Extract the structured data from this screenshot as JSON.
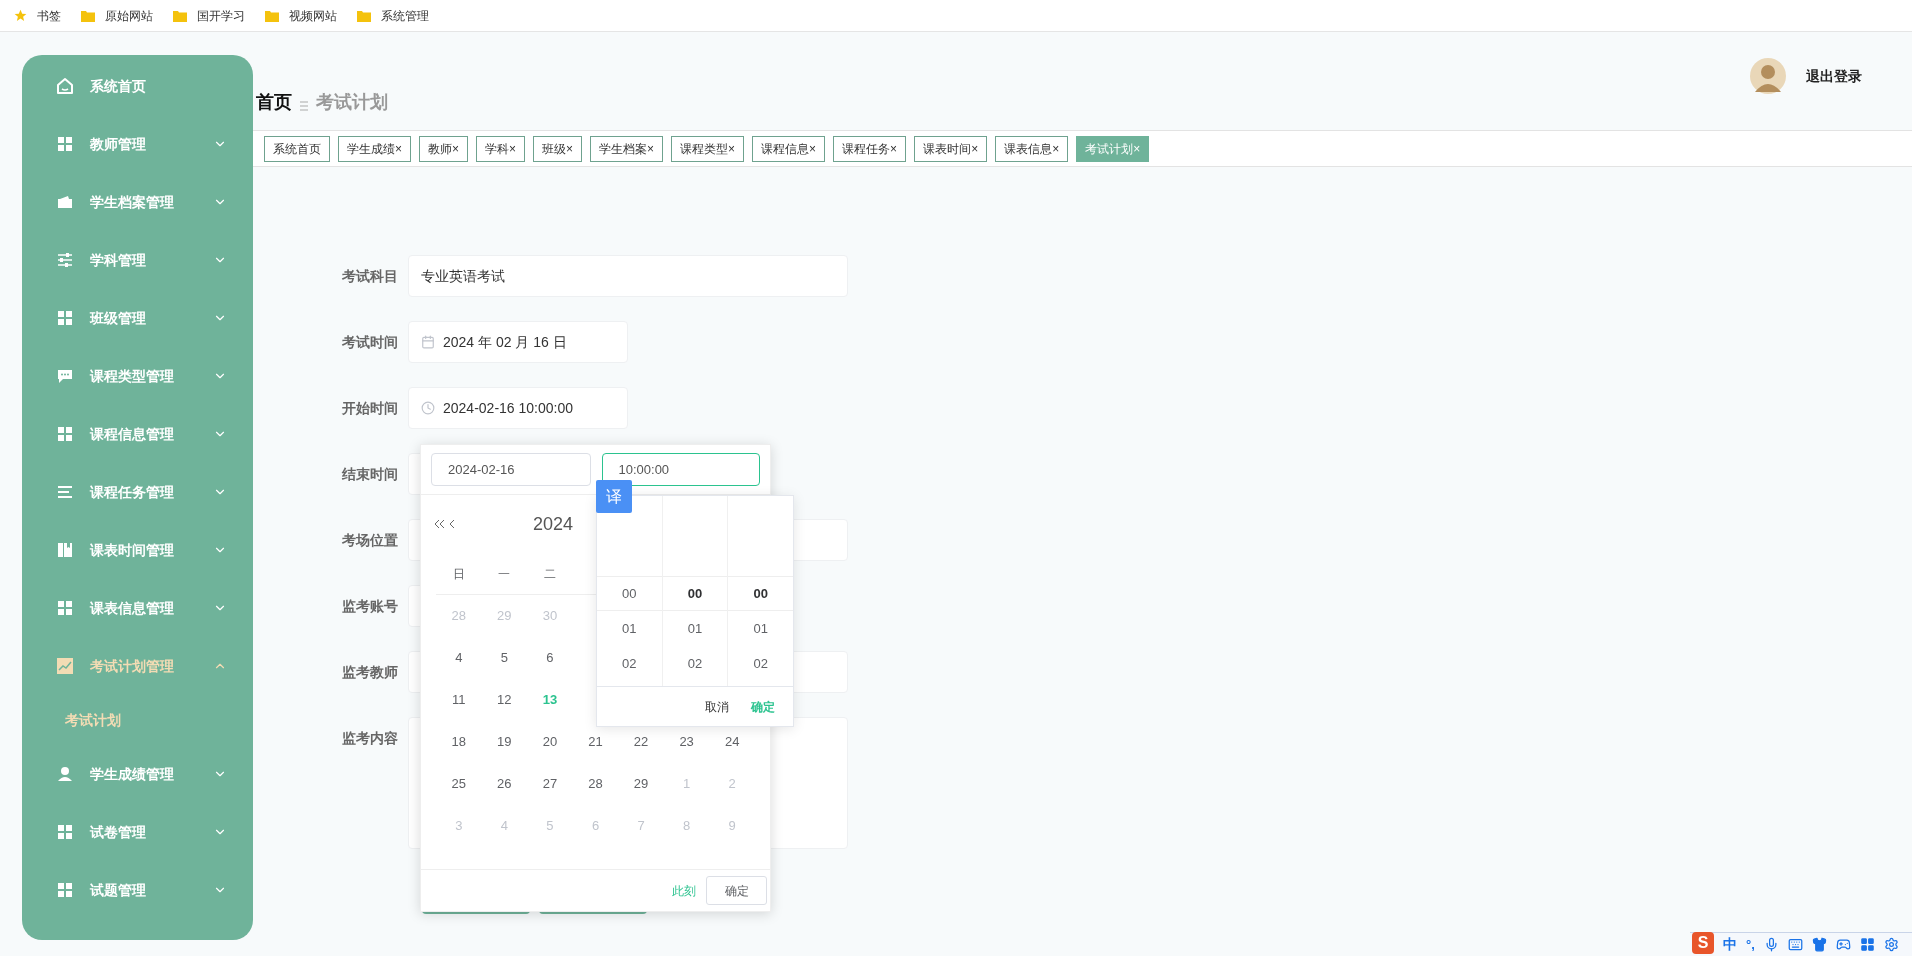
{
  "bookmarks": [
    {
      "label": "书签",
      "kind": "star"
    },
    {
      "label": "原始网站",
      "kind": "folder"
    },
    {
      "label": "国开学习",
      "kind": "folder"
    },
    {
      "label": "视频网站",
      "kind": "folder"
    },
    {
      "label": "系统管理",
      "kind": "folder"
    }
  ],
  "sidebar": {
    "items": [
      {
        "label": "系统首页",
        "kind": "home",
        "selected": false
      },
      {
        "label": "教师管理",
        "kind": "grid",
        "selected": false,
        "expanded": false
      },
      {
        "label": "学生档案管理",
        "kind": "wallet",
        "selected": false,
        "expanded": false
      },
      {
        "label": "学科管理",
        "kind": "sliders",
        "selected": false,
        "expanded": false
      },
      {
        "label": "班级管理",
        "kind": "grid",
        "selected": false,
        "expanded": false
      },
      {
        "label": "课程类型管理",
        "kind": "chat",
        "selected": false,
        "expanded": false
      },
      {
        "label": "课程信息管理",
        "kind": "grid",
        "selected": false,
        "expanded": false
      },
      {
        "label": "课程任务管理",
        "kind": "list",
        "selected": false,
        "expanded": false
      },
      {
        "label": "课表时间管理",
        "kind": "book",
        "selected": false,
        "expanded": false
      },
      {
        "label": "课表信息管理",
        "kind": "grid",
        "selected": false,
        "expanded": false
      },
      {
        "label": "考试计划管理",
        "kind": "chart",
        "selected": true,
        "expanded": true,
        "children": [
          {
            "label": "考试计划",
            "selected": true
          }
        ]
      },
      {
        "label": "学生成绩管理",
        "kind": "user",
        "selected": false,
        "expanded": false
      },
      {
        "label": "试卷管理",
        "kind": "grid",
        "selected": false,
        "expanded": false
      },
      {
        "label": "试题管理",
        "kind": "grid",
        "selected": false,
        "expanded": false
      }
    ]
  },
  "breadcrumb": {
    "home": "首页",
    "current": "考试计划"
  },
  "user": {
    "logout": "退出登录"
  },
  "tabs": [
    {
      "label": "系统首页",
      "selected": false
    },
    {
      "label": "学生成绩",
      "close": "×",
      "selected": false
    },
    {
      "label": "教师",
      "close": "×",
      "selected": false
    },
    {
      "label": "学科",
      "close": "×",
      "selected": false
    },
    {
      "label": "班级",
      "close": "×",
      "selected": false
    },
    {
      "label": "学生档案",
      "close": "×",
      "selected": false
    },
    {
      "label": "课程类型",
      "close": "×",
      "selected": false
    },
    {
      "label": "课程信息",
      "close": "×",
      "selected": false
    },
    {
      "label": "课程任务",
      "close": "×",
      "selected": false
    },
    {
      "label": "课表时间",
      "close": "×",
      "selected": false
    },
    {
      "label": "课表信息",
      "close": "×",
      "selected": false
    },
    {
      "label": "考试计划",
      "close": "×",
      "selected": true
    }
  ],
  "form": {
    "fields": [
      {
        "label": "考试科目",
        "kind": "text",
        "value": "专业英语考试"
      },
      {
        "label": "考试时间",
        "kind": "date",
        "value": "2024 年 02 月 16 日"
      },
      {
        "label": "开始时间",
        "kind": "datetime",
        "value": "2024-02-16 10:00:00"
      },
      {
        "label": "结束时间",
        "kind": "short"
      },
      {
        "label": "考场位置",
        "kind": "text"
      },
      {
        "label": "监考账号",
        "kind": "short"
      },
      {
        "label": "监考教师",
        "kind": "text"
      },
      {
        "label": "监考内容",
        "kind": "textarea"
      }
    ],
    "actions": [
      {
        "kind": "button"
      },
      {
        "kind": "button"
      }
    ]
  },
  "picker": {
    "date_input": "2024-02-16",
    "time_input": "10:00:00",
    "year": "2024",
    "weekdays": [
      "日",
      "一",
      "二"
    ],
    "weeks": [
      [
        {
          "text": "28",
          "muted": true,
          "today": false
        },
        {
          "text": "29",
          "muted": true,
          "today": false
        },
        {
          "text": "30",
          "muted": true,
          "today": false
        }
      ],
      [
        {
          "text": "4",
          "muted": false,
          "today": false
        },
        {
          "text": "5",
          "muted": false,
          "today": false
        },
        {
          "text": "6",
          "muted": false,
          "today": false
        }
      ],
      [
        {
          "text": "11",
          "muted": false,
          "today": false
        },
        {
          "text": "12",
          "muted": false,
          "today": false
        },
        {
          "text": "13",
          "muted": false,
          "today": true
        }
      ],
      [
        {
          "text": "18",
          "muted": false,
          "today": false
        },
        {
          "text": "19",
          "muted": false,
          "today": false
        },
        {
          "text": "20",
          "muted": false,
          "today": false
        },
        {
          "text": "21",
          "muted": false,
          "today": false
        },
        {
          "text": "22",
          "muted": false,
          "today": false
        },
        {
          "text": "23",
          "muted": false,
          "today": false
        },
        {
          "text": "24",
          "muted": false,
          "today": false
        }
      ],
      [
        {
          "text": "25",
          "muted": false,
          "today": false
        },
        {
          "text": "26",
          "muted": false,
          "today": false
        },
        {
          "text": "27",
          "muted": false,
          "today": false
        },
        {
          "text": "28",
          "muted": false,
          "today": false
        },
        {
          "text": "29",
          "muted": false,
          "today": false
        },
        {
          "text": "1",
          "muted": true,
          "today": false
        },
        {
          "text": "2",
          "muted": true,
          "today": false
        }
      ],
      [
        {
          "text": "3",
          "muted": true,
          "today": false
        },
        {
          "text": "4",
          "muted": true,
          "today": false
        },
        {
          "text": "5",
          "muted": true,
          "today": false
        },
        {
          "text": "6",
          "muted": true,
          "today": false
        },
        {
          "text": "7",
          "muted": true,
          "today": false
        },
        {
          "text": "8",
          "muted": true,
          "today": false
        },
        {
          "text": "9",
          "muted": true,
          "today": false
        }
      ]
    ],
    "now": "此刻",
    "ok": "确定",
    "time": {
      "badge": "译",
      "cancel": "取消",
      "confirm": "确定",
      "columns": [
        [
          {
            "text": "00",
            "selected": false
          },
          {
            "text": "01",
            "selected": false
          },
          {
            "text": "02",
            "selected": false
          }
        ],
        [
          {
            "text": "00",
            "selected": true
          },
          {
            "text": "01",
            "selected": false
          },
          {
            "text": "02",
            "selected": false
          }
        ],
        [
          {
            "text": "00",
            "selected": true
          },
          {
            "text": "01",
            "selected": false
          },
          {
            "text": "02",
            "selected": false
          }
        ]
      ]
    }
  },
  "ime": {
    "logo": "S",
    "mode": "中",
    "punct": "°,"
  }
}
